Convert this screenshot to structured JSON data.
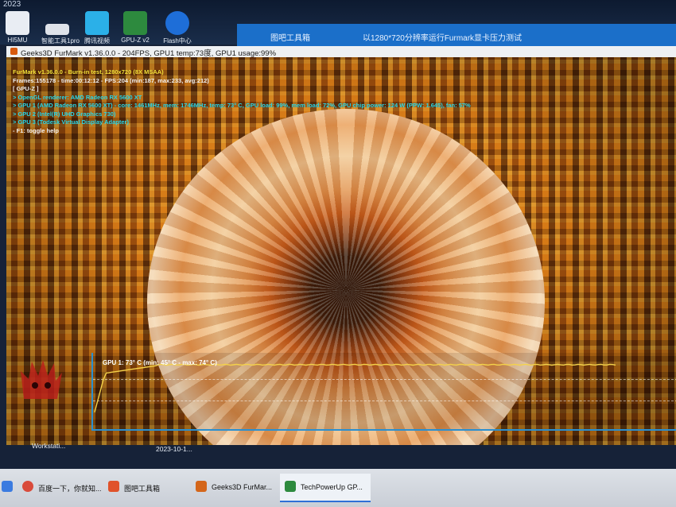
{
  "desktop": {
    "year": "2023",
    "icons": [
      {
        "label": "HI5MU"
      },
      {
        "label": "智能工具1pro"
      },
      {
        "label": "腾讯视频"
      },
      {
        "label": "GPU-Z v2"
      },
      {
        "label": "Flash中心"
      }
    ],
    "bg_tabs": [
      "图吧工具箱",
      "以1280*720分辨率运行Furmark显卡压力测试"
    ],
    "bottom_labels": [
      "Workstati...",
      "2023-10-1..."
    ]
  },
  "window": {
    "title": "Geeks3D FurMark v1.36.0.0 - 204FPS, GPU1 temp:73度, GPU1 usage:99%"
  },
  "hud": {
    "line1": "FurMark v1.36.0.0 - Burn-in test, 1280x720 (8X MSAA)",
    "line2": "Frames:155178 - time:00:12:12 - FPS:204 (min:187, max:233, avg:212)",
    "line3": "[ GPU-Z ]",
    "line4": "> OpenGL renderer: AMD Radeon RX 5600 XT",
    "line5": "> GPU 1 (AMD Radeon RX 5600 XT) - core: 1461MHz, mem: 1746MHz, temp: 73° C, GPU load: 99%, mem load: 72%, GPU chip power: 124 W (PPW: 1.645), fan: 57%",
    "line6": "> GPU 2 (Intel(R) UHD Graphics 730)",
    "line7": "> GPU 3 (Todesk Virtual Display Adapter)",
    "line8": "- F1: toggle help"
  },
  "graph": {
    "label": "GPU 1: 73° C (min: 45° C - max: 74° C)",
    "current_temp_c": 73,
    "min_temp_c": 45,
    "max_temp_c": 74
  },
  "taskbar": {
    "items": [
      {
        "label": "百度一下，你就知..."
      },
      {
        "label": "图吧工具箱"
      },
      {
        "label": "Geeks3D FurMar..."
      },
      {
        "label": "TechPowerUp GP..."
      }
    ]
  },
  "colors": {
    "hud_yellow": "#f5e23a",
    "hud_cyan": "#27d6e8",
    "graph_axis": "#2a8fd0",
    "temp_line": "#f4d24a"
  }
}
